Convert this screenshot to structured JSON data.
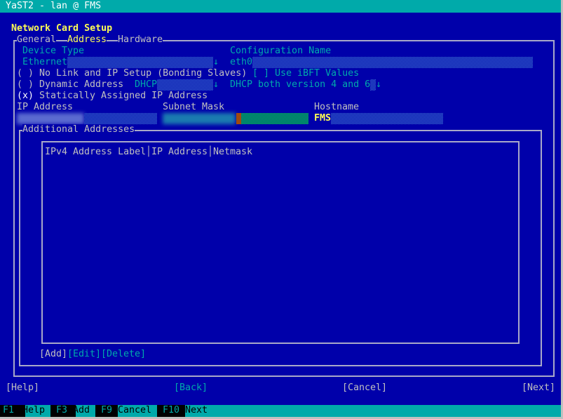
{
  "window": {
    "title": "YaST2 - lan @ FMS"
  },
  "dialog": {
    "title": "Network Card Setup"
  },
  "tabs": [
    {
      "label": "General"
    },
    {
      "label": "Address"
    },
    {
      "label": "Hardware"
    }
  ],
  "device_type": {
    "label": "Device Type",
    "value": "Ethernet"
  },
  "config_name": {
    "label": "Configuration Name",
    "value": "eth0"
  },
  "radio_no_link": {
    "mark": "( )",
    "label": "No Link and IP Setup (Bonding Slaves)"
  },
  "ibft": {
    "mark": "[ ]",
    "label": "Use iBFT Values"
  },
  "radio_dynamic": {
    "mark": "( )",
    "label": "Dynamic Address",
    "mode": "DHCP",
    "version": "DHCP both version 4 and 6"
  },
  "radio_static": {
    "mark": "(x)",
    "label": "Statically Assigned IP Address"
  },
  "ip_address": {
    "label": "IP Address",
    "value": ""
  },
  "subnet_mask": {
    "label": "Subnet Mask",
    "value": ""
  },
  "hostname": {
    "label": "Hostname",
    "value": "FMS"
  },
  "additional": {
    "title": "Additional Addresses",
    "columns": [
      "IPv4 Address Label",
      "IP Address",
      "Netmask"
    ],
    "add": "[Add]",
    "edit": "[Edit]",
    "delete": "[Delete]"
  },
  "buttons": {
    "help": "[Help]",
    "back": "[Back]",
    "cancel": "[Cancel]",
    "next": "[Next]"
  },
  "fkeys": [
    {
      "key": "F1",
      "label": "Help"
    },
    {
      "key": "F3",
      "label": "Add"
    },
    {
      "key": "F9",
      "label": "Cancel"
    },
    {
      "key": "F10",
      "label": "Next"
    }
  ]
}
